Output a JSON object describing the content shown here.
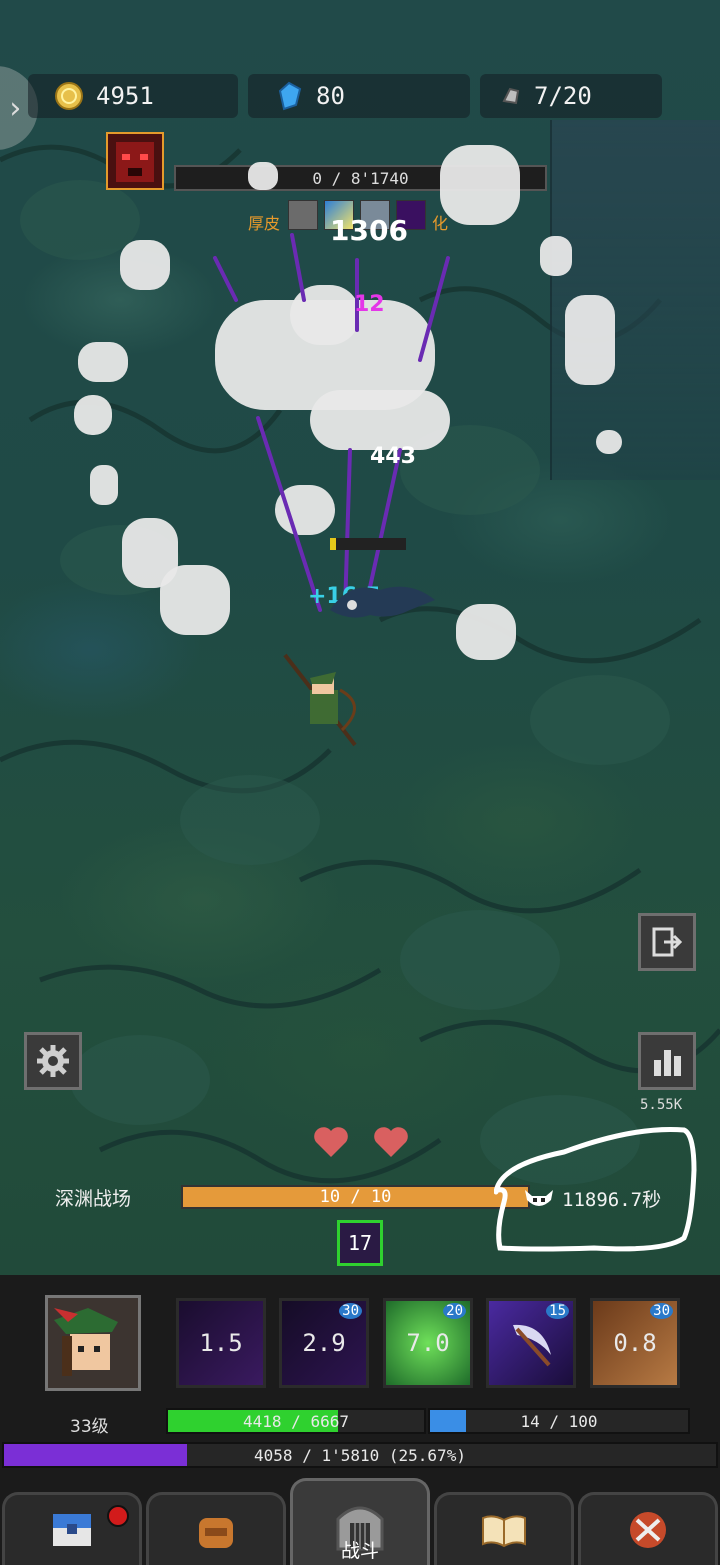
{
  "currency": {
    "gold": "4951",
    "gems": "80",
    "keys": "7/20"
  },
  "boss": {
    "hp_text": "0 / 8'1740",
    "buff_left": "厚皮",
    "buff_right": "化"
  },
  "combat_numbers": {
    "top_damage": "1306",
    "magenta": "12",
    "white": "443",
    "heal": "+16.5"
  },
  "dps_value": "5.55K",
  "stage": {
    "name": "深渊战场",
    "progress_text": "10 / 10",
    "progress_fraction": 1.0,
    "timer": "11896.7秒",
    "wave": "17"
  },
  "hero": {
    "level": "33级",
    "hp_text": "4418 / 6667",
    "hp_fraction": 0.663,
    "mp_text": "14 / 100",
    "mp_fraction": 0.14,
    "xp_text": "4058 / 1'5810 (25.67%)",
    "xp_fraction": 0.2567
  },
  "skills": [
    {
      "cooldown": "1.5",
      "level": ""
    },
    {
      "cooldown": "2.9",
      "level": "30"
    },
    {
      "cooldown": "7.0",
      "level": "20"
    },
    {
      "cooldown": "",
      "level": "15"
    },
    {
      "cooldown": "0.8",
      "level": "30"
    }
  ],
  "nav": {
    "active_label": "战斗",
    "items": [
      "shop-chest-icon",
      "backpack-icon",
      "castle-gate-icon",
      "spellbook-icon",
      "crossed-swords-icon"
    ]
  },
  "colors": {
    "hp_green": "#2fd12f",
    "mp_blue": "#3a8ee6",
    "xp_purple": "#7b2fd6",
    "stage_orange": "#e59a3a"
  }
}
